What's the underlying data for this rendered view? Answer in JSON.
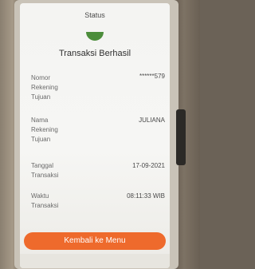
{
  "header": {
    "title": "Status"
  },
  "result": {
    "title": "Transaksi Berhasil"
  },
  "details": [
    {
      "label": "Nomor\nRekening\nTujuan",
      "value": "******579"
    },
    {
      "label": "Nama\nRekening\nTujuan",
      "value": "JULIANA"
    },
    {
      "label": "Tanggal\nTransaksi",
      "value": "17-09-2021"
    },
    {
      "label": "Waktu\nTransaksi",
      "value": "08:11:33 WIB"
    }
  ],
  "actions": {
    "back_label": "Kembali ke Menu"
  },
  "colors": {
    "accent": "#ee6a2c",
    "success": "#4c8d3b"
  }
}
